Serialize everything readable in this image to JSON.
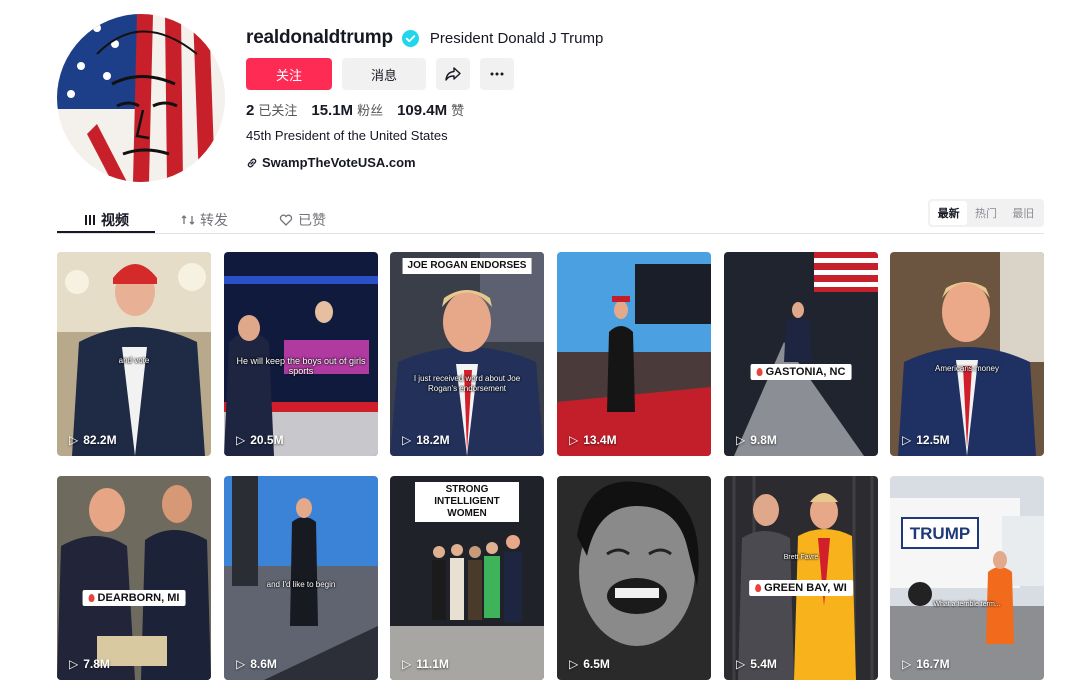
{
  "profile": {
    "username": "realdonaldtrump",
    "display_name": "President Donald J Trump",
    "follow_label": "关注",
    "message_label": "消息",
    "bio": "45th President of the United States",
    "link": "SwampTheVoteUSA.com",
    "stats": [
      {
        "value": "2",
        "label": "已关注"
      },
      {
        "value": "15.1M",
        "label": "粉丝"
      },
      {
        "value": "109.4M",
        "label": "赞"
      }
    ]
  },
  "tabs": [
    {
      "label": "视频",
      "icon": "grid-icon"
    },
    {
      "label": "转发",
      "icon": "repost-icon"
    },
    {
      "label": "已赞",
      "icon": "liked-icon"
    }
  ],
  "sort": [
    "最新",
    "热门",
    "最旧"
  ],
  "videos": [
    {
      "views": "82.2M",
      "subtitle": "and vote"
    },
    {
      "views": "20.5M",
      "subtitle": "He will keep the boys out of girls sports"
    },
    {
      "views": "18.2M",
      "caption": "JOE ROGAN ENDORSES",
      "subtitle": "I just received word about Joe Rogan's endorsement"
    },
    {
      "views": "13.4M"
    },
    {
      "views": "9.8M",
      "location": "GASTONIA, NC"
    },
    {
      "views": "12.5M",
      "subtitle": "Americans money"
    },
    {
      "views": "7.8M",
      "location": "DEARBORN, MI"
    },
    {
      "views": "8.6M",
      "subtitle": "and I'd like to begin"
    },
    {
      "views": "11.1M",
      "caption": "STRONG INTELLIGENT WOMEN"
    },
    {
      "views": "6.5M"
    },
    {
      "views": "5.4M",
      "location": "GREEN BAY, WI",
      "subtitle": "Brett Favre"
    },
    {
      "views": "16.7M",
      "subtitle": "What a terrible term..."
    }
  ],
  "colors": {
    "accent": "#fe2c55",
    "verified": "#20d5ec",
    "button_gray": "#f1f1f2"
  }
}
